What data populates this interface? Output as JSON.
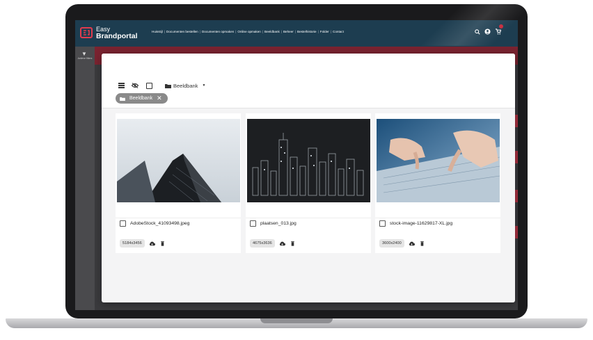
{
  "app": {
    "logo_line1": "Easy",
    "logo_line2": "Brandportal",
    "nav": [
      "Huisstijl",
      "Documenten bestellen",
      "Documenten opmaken",
      "Online opmaken",
      "Beeldbank",
      "Beheer",
      "Bestelhistorie",
      "Folder",
      "Contact"
    ],
    "colors": {
      "navbar": "#1d3d50",
      "brand_red": "#c62a3c"
    }
  },
  "rail": {
    "label": "Actieve filters"
  },
  "modal": {
    "toolbar": {
      "icons": [
        "list-icon",
        "eye-icon",
        "checkbox-icon",
        "folder-icon"
      ],
      "folder_label": "Beeldbank"
    },
    "chip": {
      "label": "Beeldbank"
    },
    "files": [
      {
        "name": "AdobeStock_41093498.jpeg",
        "dimensions": "5184x3456"
      },
      {
        "name": "plaatsen_013.jpg",
        "dimensions": "4675x3636"
      },
      {
        "name": "stock-image-11629817-XL.jpg",
        "dimensions": "3600x2400"
      }
    ]
  }
}
